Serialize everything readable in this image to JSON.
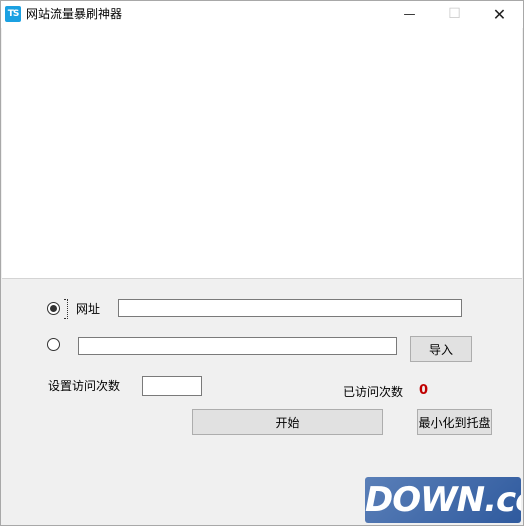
{
  "window": {
    "title": "网站流量暴刷神器",
    "icon_text": "TS",
    "minimize_glyph": "—",
    "maximize_glyph": "☐",
    "close_glyph": "✕"
  },
  "form": {
    "url_label": "网址",
    "url_value": "",
    "file_path_value": "",
    "import_button": "导入",
    "visits_label": "设置访问次数",
    "visits_value": "",
    "visited_label": "已访问次数",
    "visited_count": "0",
    "start_button": "开始",
    "tray_button": "最小化到托盘"
  },
  "watermark": {
    "text": "DOWN.cc"
  },
  "colors": {
    "count_color": "#c00000",
    "watermark_bg": "#3d66a8"
  }
}
